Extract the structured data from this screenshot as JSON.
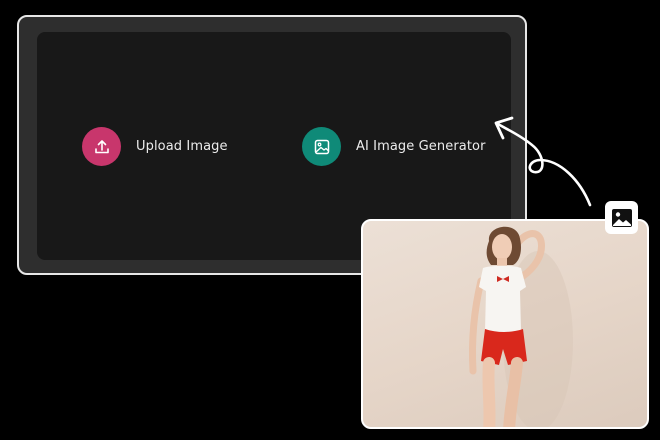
{
  "options": {
    "upload": {
      "label": "Upload Image",
      "icon": "upload-icon",
      "color": "#c8366c"
    },
    "ai_generator": {
      "label": "AI Image Generator",
      "icon": "image-icon",
      "color": "#0f8a78"
    }
  },
  "badge": {
    "icon": "image-icon"
  },
  "colors": {
    "background": "#000000",
    "panel": "#2e2e2e",
    "panel_inner": "#181818",
    "photo_background": "#e8dbcf",
    "shorts": "#d9281c"
  }
}
